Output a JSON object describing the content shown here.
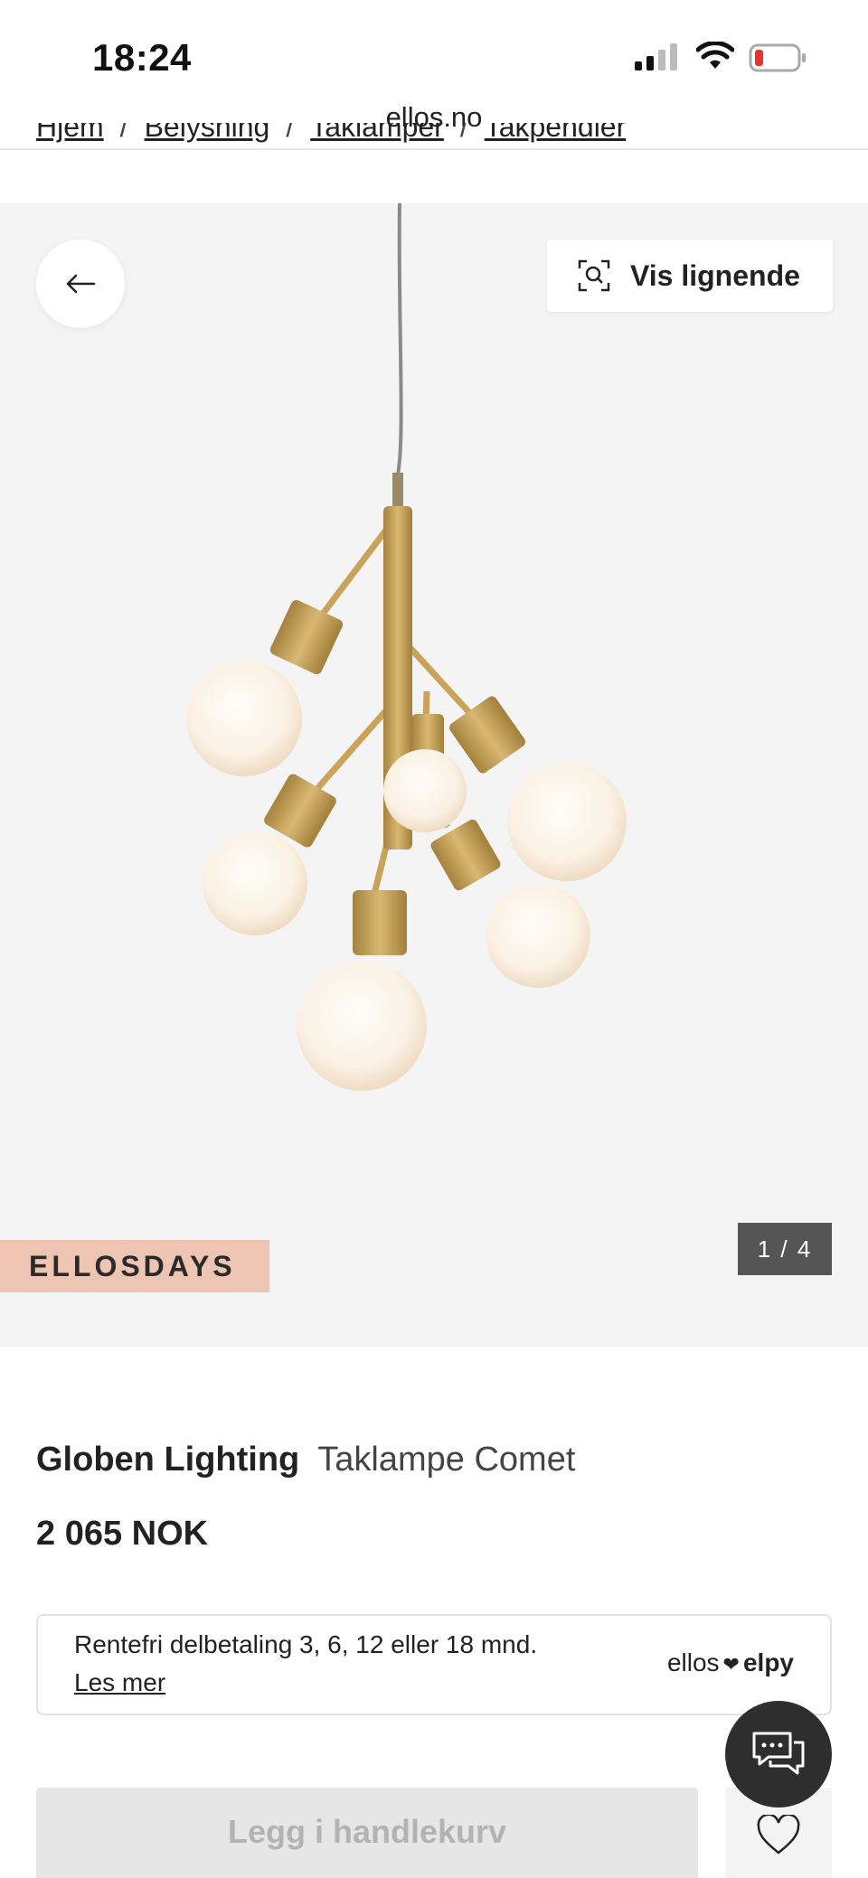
{
  "status_bar": {
    "time": "18:24"
  },
  "browser": {
    "url": "ellos.no"
  },
  "breadcrumb": [
    "Hjem",
    "Belysning",
    "Taklamper",
    "Takpendler"
  ],
  "breadcrumb_separator": "/",
  "gallery": {
    "similar_label": "Vis lignende",
    "promo_tag": "ELLOSDAYS",
    "counter": "1 / 4",
    "current_image": 1,
    "total_images": 4
  },
  "product": {
    "brand": "Globen Lighting",
    "name": "Taklampe Comet",
    "price": "2 065 NOK"
  },
  "payment": {
    "text": "Rentefri delbetaling 3, 6, 12 eller 18 mnd.",
    "link": "Les mer",
    "logo_left": "ellos",
    "logo_right": "elpy"
  },
  "actions": {
    "add_to_cart": "Legg i handlekurv"
  },
  "colors": {
    "promo_bg": "#eec4b2",
    "gallery_bg": "#f4f4f4",
    "counter_bg": "#555555",
    "chat_bg": "#2e2e2e",
    "brass": "#c9a35a"
  }
}
